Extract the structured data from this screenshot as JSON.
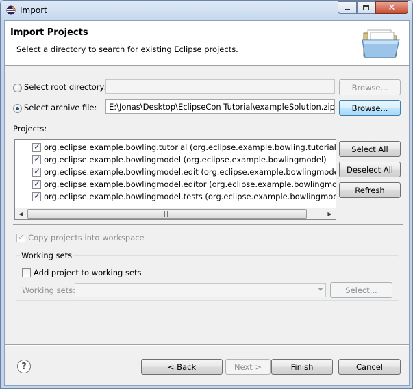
{
  "window": {
    "title": "Import",
    "controls": {
      "minimize": "minimize-icon",
      "maximize": "maximize-icon",
      "close": "close-icon"
    }
  },
  "header": {
    "title": "Import Projects",
    "subtitle": "Select a directory to search for existing Eclipse projects."
  },
  "source": {
    "root_label": "Select root directory:",
    "root_value": "",
    "root_browse": "Browse...",
    "archive_label": "Select archive file:",
    "archive_value": "E:\\Jonas\\Desktop\\EclipseCon Tutorial\\exampleSolution.zip",
    "archive_browse": "Browse...",
    "selected": "archive"
  },
  "projects": {
    "label": "Projects:",
    "items": [
      {
        "text": "org.eclipse.example.bowling.tutorial (org.eclipse.example.bowling.tutorial)",
        "checked": true
      },
      {
        "text": "org.eclipse.example.bowlingmodel (org.eclipse.example.bowlingmodel)",
        "checked": true
      },
      {
        "text": "org.eclipse.example.bowlingmodel.edit (org.eclipse.example.bowlingmodel.edit)",
        "checked": true
      },
      {
        "text": "org.eclipse.example.bowlingmodel.editor (org.eclipse.example.bowlingmodel.editor)",
        "checked": true
      },
      {
        "text": "org.eclipse.example.bowlingmodel.tests (org.eclipse.example.bowlingmodel.tests)",
        "checked": true
      }
    ],
    "select_all": "Select All",
    "deselect_all": "Deselect All",
    "refresh": "Refresh"
  },
  "copy_into_workspace": {
    "label": "Copy projects into workspace",
    "checked": true,
    "enabled": false
  },
  "working_sets": {
    "title": "Working sets",
    "add_label": "Add project to working sets",
    "add_checked": false,
    "sets_label": "Working sets:",
    "sets_value": "",
    "select_button": "Select..."
  },
  "footer": {
    "help_icon": "?",
    "back": "< Back",
    "next": "Next >",
    "finish": "Finish",
    "cancel": "Cancel"
  },
  "colors": {
    "accent": "#3c7fb1",
    "disabled_text": "#8d8d8d"
  }
}
